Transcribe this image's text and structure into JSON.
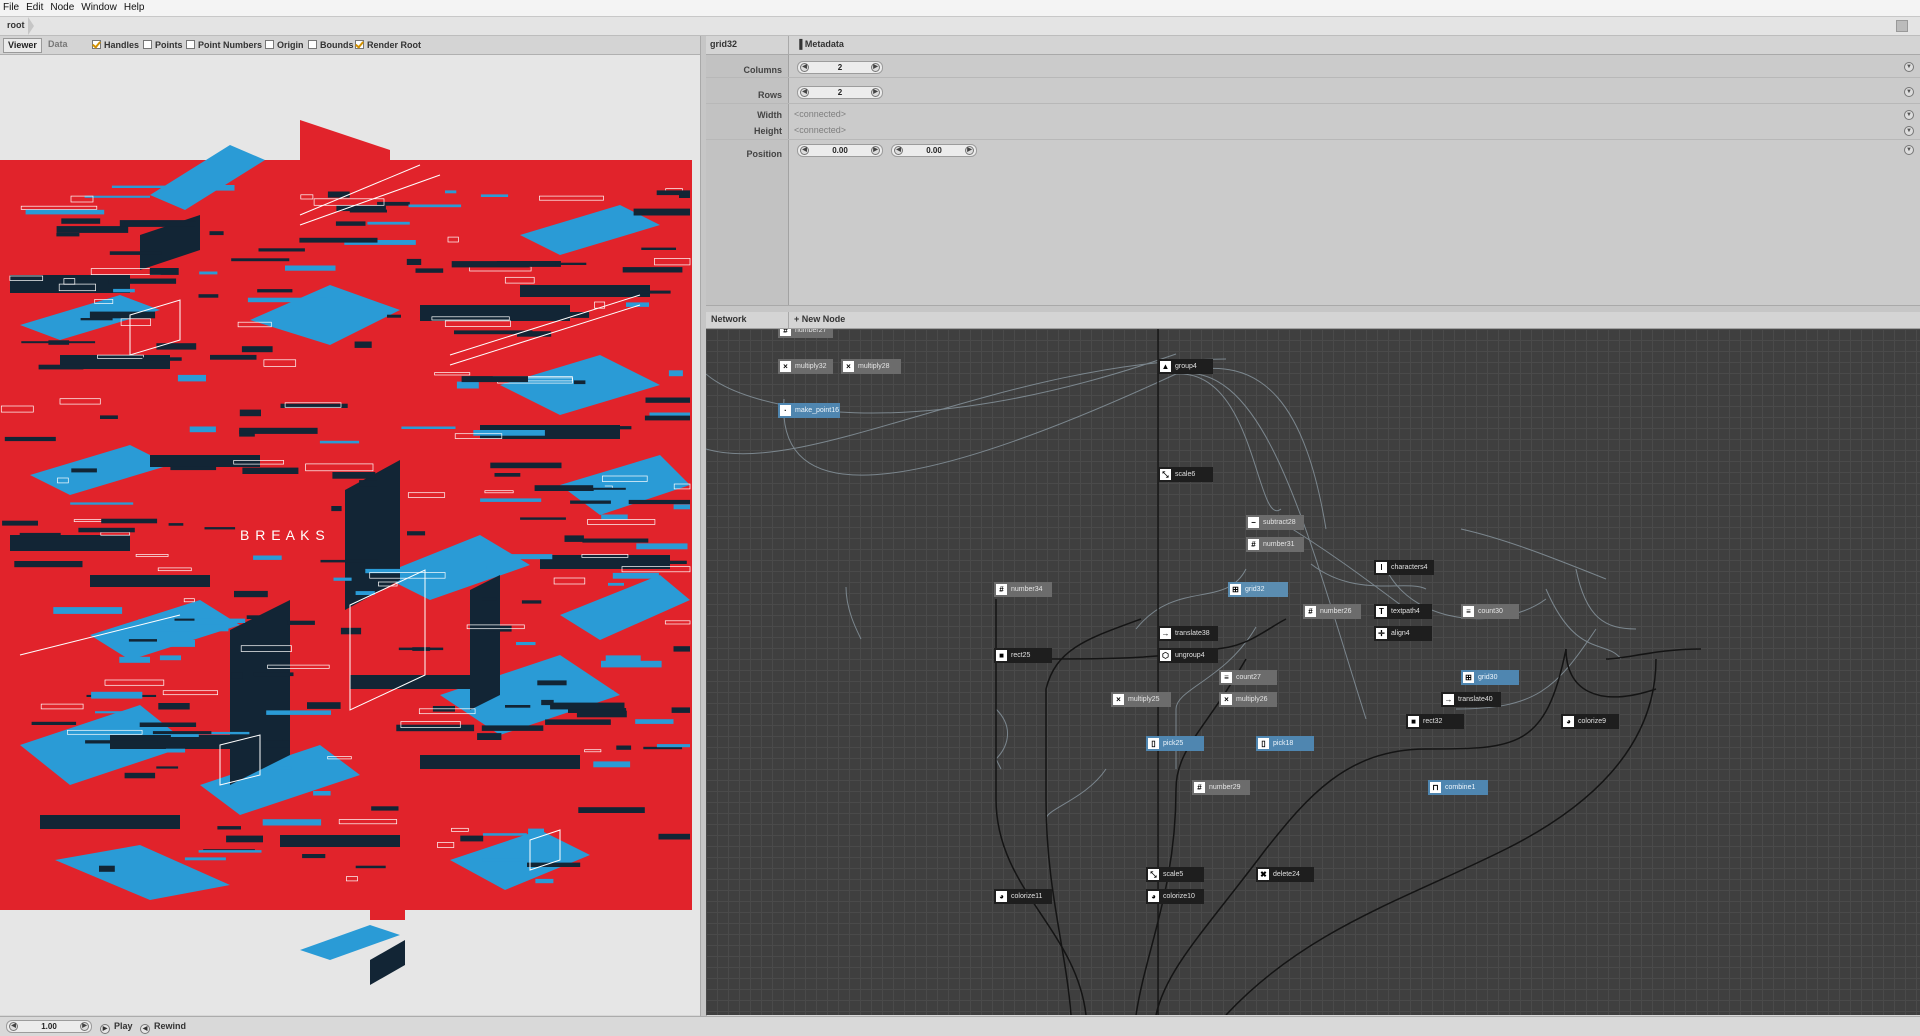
{
  "menu": [
    "File",
    "Edit",
    "Node",
    "Window",
    "Help"
  ],
  "address": {
    "root": "root"
  },
  "viewer_bar": {
    "tabs": [
      "Viewer",
      "Data"
    ],
    "options": [
      {
        "label": "Handles",
        "checked": true
      },
      {
        "label": "Points",
        "checked": false
      },
      {
        "label": "Point Numbers",
        "checked": false
      },
      {
        "label": "Origin",
        "checked": false
      },
      {
        "label": "Bounds",
        "checked": false
      },
      {
        "label": "Render Root",
        "checked": true
      }
    ]
  },
  "artwork": {
    "title": "B R E A K S",
    "colors": {
      "red": "#e1232b",
      "blue": "#2a9bd6",
      "navy": "#122535",
      "white": "#ffffff"
    }
  },
  "params": {
    "node_name": "grid32",
    "metadata_label": "Metadata",
    "columns_label": "Columns",
    "columns_value": "2",
    "rows_label": "Rows",
    "rows_value": "2",
    "width_label": "Width",
    "width_value": "<connected>",
    "height_label": "Height",
    "height_value": "<connected>",
    "position_label": "Position",
    "position_x": "0.00",
    "position_y": "0.00"
  },
  "network": {
    "title": "Network",
    "new_node": "New Node",
    "nodes": [
      {
        "id": "number27",
        "label": "number27",
        "style": "gray"
      },
      {
        "id": "multiply32",
        "label": "multiply32",
        "style": "gray"
      },
      {
        "id": "multiply28",
        "label": "multiply28",
        "style": "gray"
      },
      {
        "id": "make_point16",
        "label": "make_point16",
        "style": "blue"
      },
      {
        "id": "group4",
        "label": "group4",
        "style": "dark"
      },
      {
        "id": "scale6",
        "label": "scale6",
        "style": "dark"
      },
      {
        "id": "subtract28",
        "label": "subtract28",
        "style": "gray"
      },
      {
        "id": "number31",
        "label": "number31",
        "style": "gray"
      },
      {
        "id": "grid32",
        "label": "grid32",
        "style": "sel"
      },
      {
        "id": "number34",
        "label": "number34",
        "style": "gray"
      },
      {
        "id": "number26",
        "label": "number26",
        "style": "gray"
      },
      {
        "id": "characters4",
        "label": "characters4",
        "style": "dark"
      },
      {
        "id": "textpath4",
        "label": "textpath4",
        "style": "dark"
      },
      {
        "id": "count30",
        "label": "count30",
        "style": "gray"
      },
      {
        "id": "align4",
        "label": "align4",
        "style": "dark"
      },
      {
        "id": "translate38",
        "label": "translate38",
        "style": "dark"
      },
      {
        "id": "rect25",
        "label": "rect25",
        "style": "dark"
      },
      {
        "id": "ungroup4",
        "label": "ungroup4",
        "style": "dark"
      },
      {
        "id": "count27",
        "label": "count27",
        "style": "gray"
      },
      {
        "id": "grid30",
        "label": "grid30",
        "style": "blue"
      },
      {
        "id": "multiply25",
        "label": "multiply25",
        "style": "gray"
      },
      {
        "id": "multiply26",
        "label": "multiply26",
        "style": "gray"
      },
      {
        "id": "translate40",
        "label": "translate40",
        "style": "dark"
      },
      {
        "id": "rect32",
        "label": "rect32",
        "style": "dark"
      },
      {
        "id": "colorize9",
        "label": "colorize9",
        "style": "dark"
      },
      {
        "id": "pick25",
        "label": "pick25",
        "style": "blue"
      },
      {
        "id": "pick18",
        "label": "pick18",
        "style": "blue"
      },
      {
        "id": "combine1",
        "label": "combine1",
        "style": "blue"
      },
      {
        "id": "number29",
        "label": "number29",
        "style": "gray"
      },
      {
        "id": "scale5",
        "label": "scale5",
        "style": "dark"
      },
      {
        "id": "delete24",
        "label": "delete24",
        "style": "dark"
      },
      {
        "id": "colorize11",
        "label": "colorize11",
        "style": "dark"
      },
      {
        "id": "colorize10",
        "label": "colorize10",
        "style": "dark"
      }
    ]
  },
  "status": {
    "frame": "1.00",
    "play": "Play",
    "rewind": "Rewind"
  }
}
